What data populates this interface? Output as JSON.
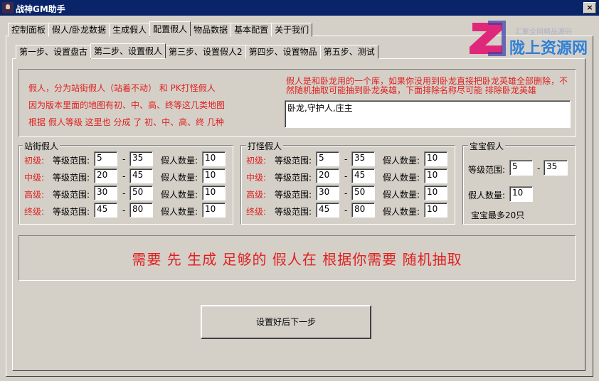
{
  "window": {
    "title": "战神GM助手",
    "close_label": "×"
  },
  "top_tabs": [
    "控制面板",
    "假人/卧龙数据",
    "生成假人",
    "配置假人",
    "物品数据",
    "基本配置",
    "关于我们"
  ],
  "sub_tabs": [
    "第一步、设置盘古",
    "第二步、设置假人",
    "第三步、设置假人2",
    "第四步、设置物品",
    "第五步、测试"
  ],
  "info": {
    "line1": "假人，分为站街假人（站着不动） 和 PK打怪假人",
    "line2": "因为版本里面的地图有初、中、高、终等这几类地图",
    "line3": "根据 假人等级 这里也 分成 了 初、中、高、终 几种",
    "note": "假人是和卧龙用的一个库，如果你没用到卧龙直接把卧龙英雄全部删除，不然随机抽取可能抽到卧龙英雄，下面排除名称尽可能 排除卧龙英雄",
    "exclude_names": "卧龙,守护人,庄主"
  },
  "street": {
    "title": "站街假人",
    "range_label": "等级范围:",
    "count_label": "假人数量:",
    "dash": "-",
    "rows": [
      {
        "tier": "初级:",
        "min": "5",
        "max": "35",
        "count": "10"
      },
      {
        "tier": "中级:",
        "min": "20",
        "max": "45",
        "count": "10"
      },
      {
        "tier": "高级:",
        "min": "30",
        "max": "50",
        "count": "10"
      },
      {
        "tier": "终级:",
        "min": "45",
        "max": "80",
        "count": "10"
      }
    ]
  },
  "fight": {
    "title": "打怪假人",
    "range_label": "等级范围:",
    "count_label": "假人数量:",
    "dash": "-",
    "rows": [
      {
        "tier": "初级:",
        "min": "5",
        "max": "35",
        "count": "10"
      },
      {
        "tier": "中级:",
        "min": "20",
        "max": "45",
        "count": "10"
      },
      {
        "tier": "高级:",
        "min": "30",
        "max": "50",
        "count": "10"
      },
      {
        "tier": "终级:",
        "min": "45",
        "max": "80",
        "count": "10"
      }
    ]
  },
  "pet": {
    "title": "宝宝假人",
    "range_label": "等级范围:",
    "min": "5",
    "dash": "-",
    "max": "35",
    "count_label": "假人数量:",
    "count": "10",
    "note": "宝宝最多20只"
  },
  "banner": "需要 先 生成 足够的 假人在 根据你需要 随机抽取",
  "next_button": "设置好后下一步",
  "watermark": {
    "small": "汇聚全网精品源码",
    "big": "陇上资源网"
  },
  "colors": {
    "title_bar": "#0a246a",
    "window_bg": "#d4d0c8",
    "red_text": "#e02020",
    "watermark_blue": "#3080d8"
  }
}
